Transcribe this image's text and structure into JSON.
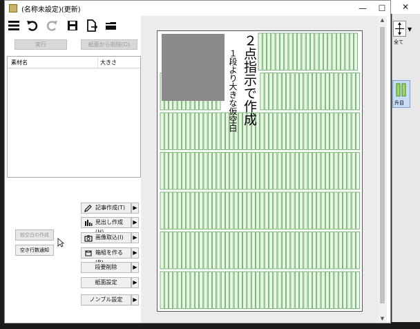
{
  "window": {
    "title": "(名称未設定)(更新)",
    "controls": {
      "minimize": "—",
      "maximize": "☐",
      "close": "✕"
    }
  },
  "toolbar": {
    "icons": [
      "menu-icon",
      "undo-icon",
      "redo-icon",
      "save-icon",
      "export-page-icon",
      "folder-icon"
    ]
  },
  "buttons": {
    "execute": "実行",
    "remove_from_page": "紙面から削除(D)"
  },
  "material_list": {
    "columns": [
      "素材名",
      "大きさ"
    ],
    "rows": []
  },
  "actions": [
    {
      "label": "記事作成(T)",
      "icon": "pencil-icon"
    },
    {
      "label": "見出し作成(H)",
      "icon": "heading-chart-icon"
    },
    {
      "label": "画像取込(I)",
      "icon": "camera-icon"
    },
    {
      "label": "箱組を作る(B)",
      "icon": "box-icon"
    },
    {
      "label": "段要削除",
      "icon": ""
    },
    {
      "label": "紙面設定",
      "icon": ""
    },
    {
      "label": "ノンブル設定",
      "icon": ""
    }
  ],
  "left_buttons": {
    "create_blank": "仮空白の作成",
    "notify_blank_lines": "空き行数通知"
  },
  "page": {
    "headline": "２点指示で作成",
    "subheadline": "１段より大きな仮空白"
  },
  "right_panel": {
    "all_label": "全て",
    "ascend_label": "升目",
    "dropdown": "▼"
  },
  "colors": {
    "grid_green": "#2e8b2e",
    "grid_fill": "#e9f6e4",
    "photo_gray": "#8a8a8a",
    "active_panel": "#c9dcf5"
  }
}
